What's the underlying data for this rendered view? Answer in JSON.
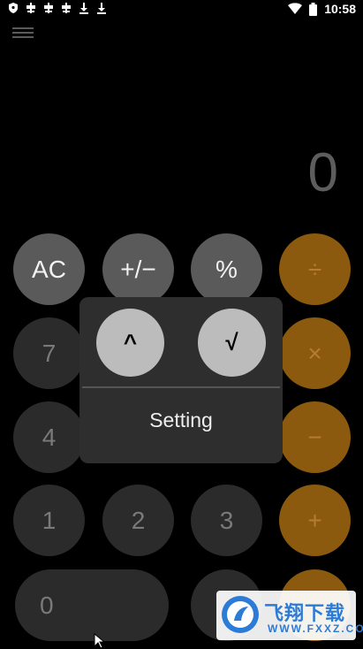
{
  "status_bar": {
    "time": "10:58",
    "icons": [
      "shield-icon",
      "bug-icon",
      "bug-icon",
      "bug-icon",
      "download-icon",
      "download-icon",
      "wifi-icon",
      "battery-icon"
    ]
  },
  "display": {
    "value": "0"
  },
  "keys": {
    "ac": "AC",
    "plus_minus": "+/−",
    "percent": "%",
    "divide": "÷",
    "seven": "7",
    "multiply": "×",
    "four": "4",
    "minus": "−",
    "one": "1",
    "two": "2",
    "three": "3",
    "plus": "+",
    "zero": "0"
  },
  "popup": {
    "power": "^",
    "sqrt": "√",
    "setting": "Setting"
  },
  "watermark": {
    "brand": "飞翔下载",
    "url": "WWW.FXXZ.COM"
  },
  "colors": {
    "background": "#000000",
    "gray_key": "#5a5a5a",
    "dark_key": "#2b2b2b",
    "orange_key": "#8c5a0f",
    "popup_bg": "#2e2e2e",
    "popup_key": "#bcbcbc"
  }
}
